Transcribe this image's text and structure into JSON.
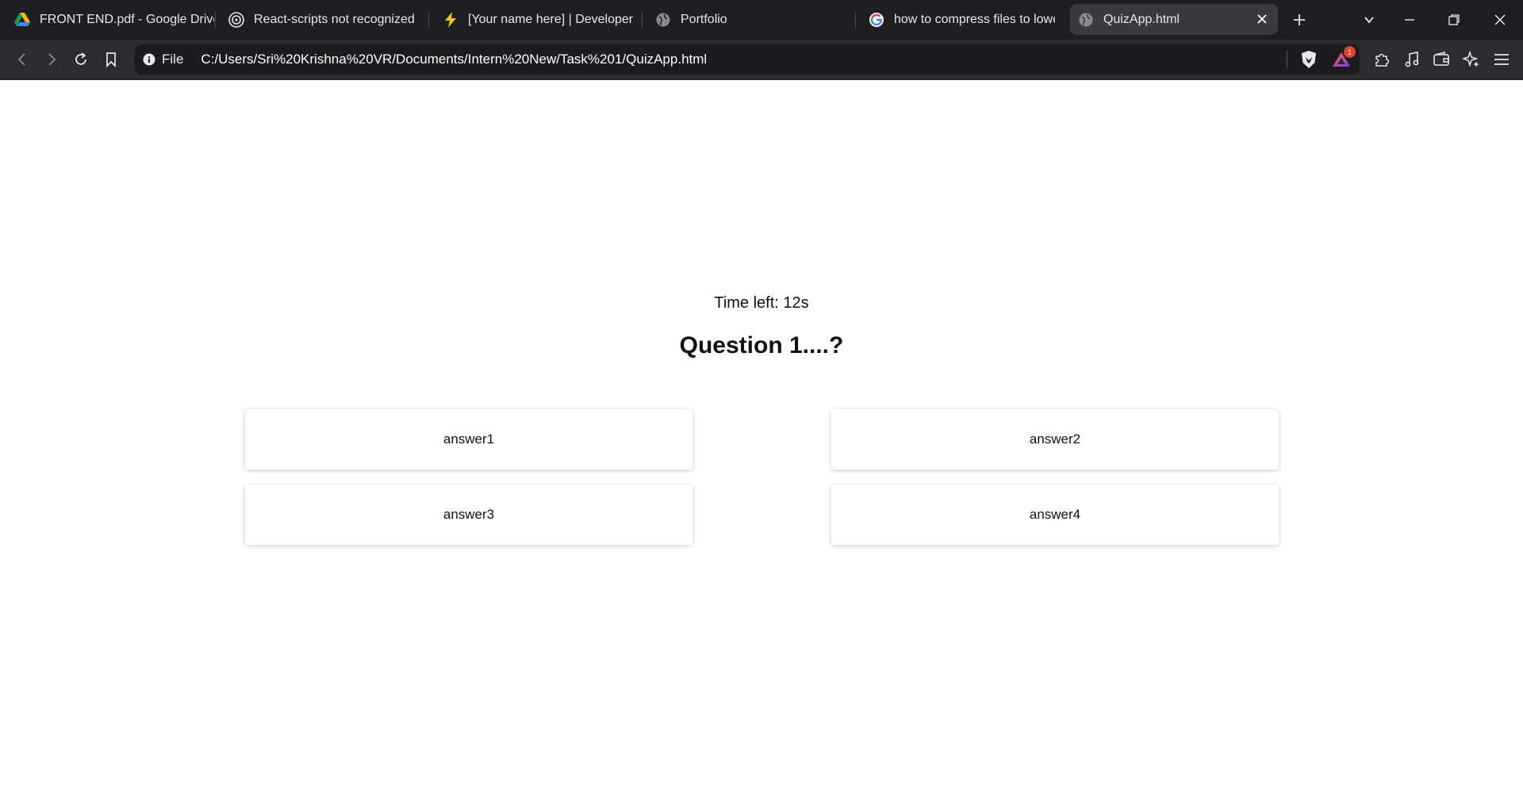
{
  "browser": {
    "tabs": [
      {
        "title": "FRONT END.pdf - Google Drive",
        "icon": "google-drive-icon",
        "active": false
      },
      {
        "title": "React-scripts not recognized",
        "icon": "openai-icon",
        "active": false
      },
      {
        "title": "[Your name here] | Developer",
        "icon": "lightning-icon",
        "active": false
      },
      {
        "title": "Portfolio",
        "icon": "globe-icon",
        "active": false
      },
      {
        "title": "how to compress files to lower",
        "icon": "google-icon",
        "active": false
      },
      {
        "title": "QuizApp.html",
        "icon": "globe-icon",
        "active": true
      }
    ],
    "address_bar": {
      "site_info_label": "File",
      "url": "C:/Users/Sri%20Krishna%20VR/Documents/Intern%20New/Task%201/QuizApp.html",
      "rewards_badge": "1"
    },
    "colors": {
      "tabstrip_bg": "#1f1f23",
      "toolbar_bg": "#2b2b30",
      "active_tab_bg": "#3a3a3f"
    }
  },
  "quiz": {
    "timer_text": "Time left: 12s",
    "question_text": "Question 1....?",
    "answers": [
      "answer1",
      "answer2",
      "answer3",
      "answer4"
    ]
  }
}
